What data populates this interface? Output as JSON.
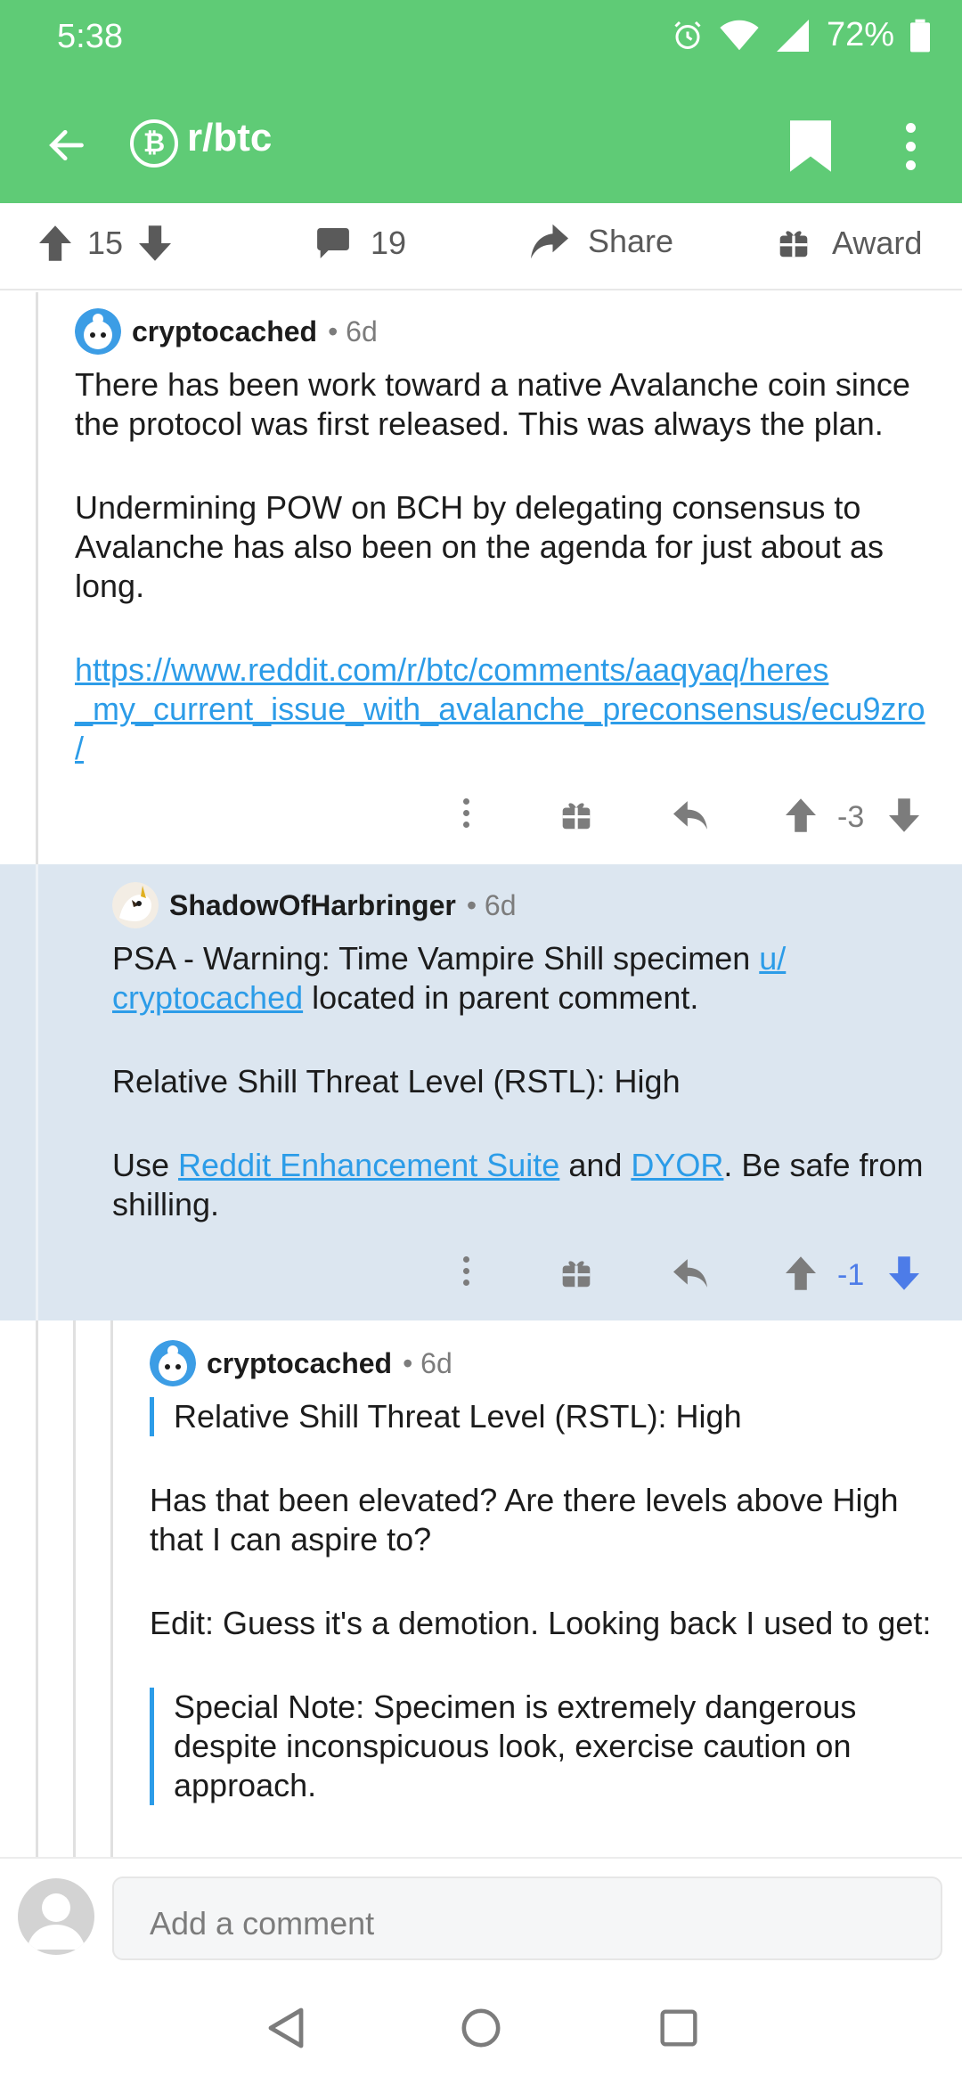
{
  "status": {
    "time": "5:38",
    "battery": "72%"
  },
  "appbar": {
    "subreddit": "r/btc",
    "subreddit_icon": "bitcoin-icon"
  },
  "post_actions": {
    "score": "15",
    "comments": "19",
    "share_label": "Share",
    "award_label": "Award"
  },
  "comments": [
    {
      "author": "cryptocached",
      "age": "6d",
      "paragraphs": [
        "There has been work toward a native Avalanche coin since the protocol was first released. This was always the plan.",
        "Undermining POW on BCH by delegating consensus to Avalanche has also been on the agenda for just about as long."
      ],
      "link_line1": "https://www.reddit.com/r/btc/comments/aaqyaq/heres",
      "link_line2": "_my_current_issue_with_avalanche_preconsensus/ecu9zro",
      "link_line3": "/",
      "score": "-3"
    },
    {
      "author": "ShadowOfHarbringer",
      "age": "6d",
      "p1_prefix": "PSA - Warning: Time Vampire Shill specimen ",
      "p1_link_a": "u/",
      "p1_link_b": "cryptocached",
      "p1_suffix": " located in parent comment.",
      "p2": "Relative Shill Threat Level (RSTL): High",
      "p3_prefix": "Use ",
      "p3_link1": "Reddit Enhancement Suite",
      "p3_mid": " and ",
      "p3_link2": "DYOR",
      "p3_suffix": ". Be safe from shilling.",
      "score": "-1"
    },
    {
      "author": "cryptocached",
      "age": "6d",
      "quote1": "Relative Shill Threat Level (RSTL): High",
      "p1": "Has that been elevated? Are there levels above High that I can aspire to?",
      "p2": "Edit: Guess it's a demotion. Looking back I used to get:",
      "quote2": "Special Note: Specimen is extremely dangerous despite inconspicuous look, exercise caution on approach."
    }
  ],
  "composer": {
    "placeholder": "Add a comment"
  },
  "colors": {
    "header_green": "#5fcb76",
    "link_blue": "#2c9ce8",
    "highlight_bg": "#dce6f0",
    "downvote_blue": "#4d7ce8"
  }
}
